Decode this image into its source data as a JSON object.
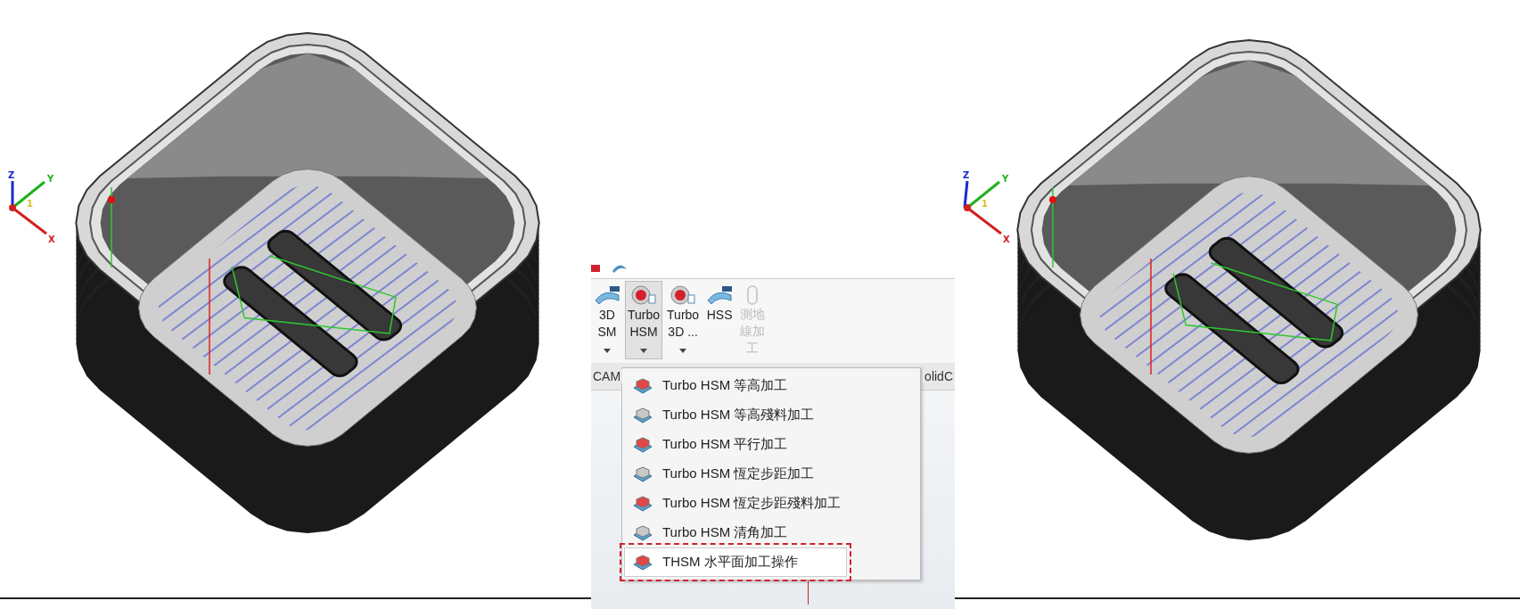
{
  "viewports": [
    {
      "axes": {
        "z": "Z",
        "y": "Y",
        "x": "X",
        "origin": "1"
      }
    },
    {
      "axes": {
        "z": "Z",
        "y": "Y",
        "x": "X",
        "origin": "1"
      }
    }
  ],
  "ribbon": {
    "buttons": [
      {
        "lines": [
          "3D",
          "SM"
        ],
        "selected": false,
        "disabled": false,
        "dropdown": true
      },
      {
        "lines": [
          "Turbo",
          "HSM"
        ],
        "selected": true,
        "disabled": false,
        "dropdown": true
      },
      {
        "lines": [
          "Turbo",
          "3D ..."
        ],
        "selected": false,
        "disabled": false,
        "dropdown": true
      },
      {
        "lines": [
          "HSS"
        ],
        "selected": false,
        "disabled": false,
        "dropdown": false
      },
      {
        "lines": [
          "測地",
          "線加",
          "工"
        ],
        "selected": false,
        "disabled": true,
        "dropdown": false
      }
    ],
    "tabs": [
      "CAM",
      "olidC"
    ]
  },
  "menu": {
    "items": [
      {
        "label": "Turbo HSM 等高加工",
        "highlighted": false
      },
      {
        "label": "Turbo HSM 等高殘料加工",
        "highlighted": false
      },
      {
        "label": "Turbo HSM 平行加工",
        "highlighted": false
      },
      {
        "label": "Turbo HSM 恆定步距加工",
        "highlighted": false
      },
      {
        "label": "Turbo HSM 恆定步距殘料加工",
        "highlighted": false
      },
      {
        "label": "Turbo HSM 清角加工",
        "highlighted": false
      },
      {
        "label": "THSM 水平面加工操作",
        "highlighted": true
      }
    ]
  }
}
